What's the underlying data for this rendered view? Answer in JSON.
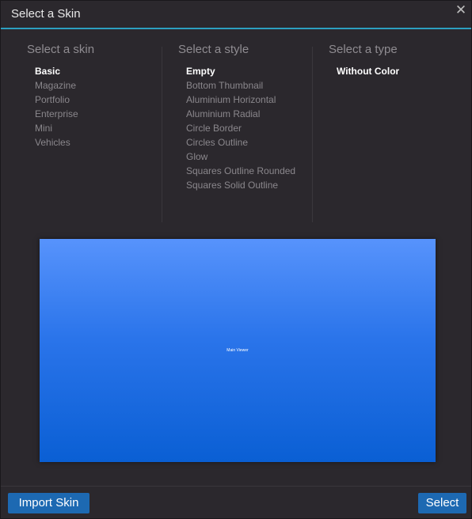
{
  "dialog": {
    "title": "Select a Skin",
    "close_icon": "close-icon"
  },
  "skins": {
    "header": "Select a skin",
    "items": [
      "Basic",
      "Magazine",
      "Portfolio",
      "Enterprise",
      "Mini",
      "Vehicles"
    ],
    "selected": "Basic"
  },
  "styles": {
    "header": "Select a style",
    "items": [
      "Empty",
      "Bottom Thumbnail",
      "Aluminium Horizontal",
      "Aluminium Radial",
      "Circle Border",
      "Circles Outline",
      "Glow",
      "Squares Outline Rounded",
      "Squares Solid Outline"
    ],
    "selected": "Empty"
  },
  "types": {
    "header": "Select a type",
    "items": [
      "Without Color"
    ],
    "selected": "Without Color"
  },
  "preview": {
    "label": "Main Viewer"
  },
  "footer": {
    "import_label": "Import Skin",
    "select_label": "Select"
  },
  "colors": {
    "accent": "#2c9fc0",
    "button": "#1d69b2",
    "background": "#2b282d"
  }
}
